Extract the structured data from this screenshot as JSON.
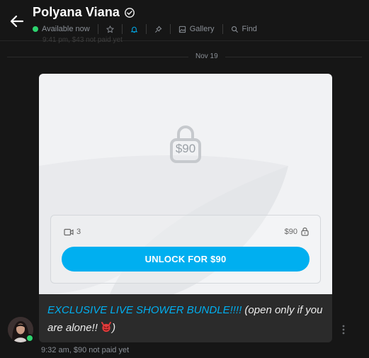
{
  "header": {
    "name": "Polyana Viana",
    "status": "Available now",
    "gallery_label": "Gallery",
    "find_label": "Find"
  },
  "colors": {
    "accent": "#00aff0",
    "online": "#2dd36f"
  },
  "icons": {
    "back": "arrow-left-icon",
    "verified": "verified-check-icon",
    "star": "star-icon",
    "bell": "bell-icon",
    "pin": "pin-icon",
    "gallery": "image-icon",
    "find": "search-icon",
    "lock": "lock-icon",
    "video": "video-icon",
    "more": "more-vertical-icon"
  },
  "previous_message_hint": "9:41 pm, $43 not paid yet",
  "date_divider": "Nov 19",
  "locked_media": {
    "price_badge": "$90",
    "video_count": "3",
    "price": "$90",
    "unlock_label": "UNLOCK FOR $90"
  },
  "message": {
    "highlight": "EXCLUSIVE LIVE SHOWER BUNDLE!!!!",
    "rest": " (open only if you are alone!! ",
    "close": ")",
    "time": "9:32 am, ",
    "payment_status": "$90 not paid yet"
  }
}
